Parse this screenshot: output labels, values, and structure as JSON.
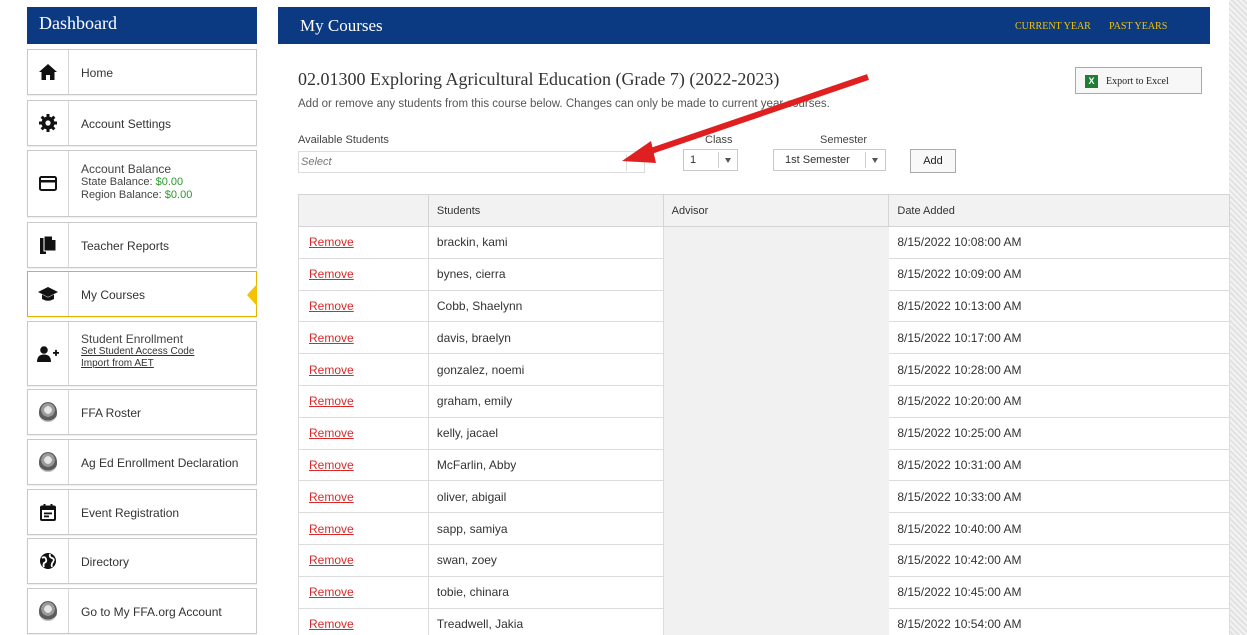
{
  "sidebar": {
    "title": "Dashboard",
    "items": [
      {
        "label": "Home",
        "icon": "home-icon"
      },
      {
        "label": "Account Settings",
        "icon": "gear-icon"
      },
      {
        "label": "Account Balance",
        "icon": "credit-card-icon",
        "lines": [
          {
            "prefix": "State Balance:",
            "value": "$0.00"
          },
          {
            "prefix": "Region Balance:",
            "value": "$0.00"
          }
        ]
      },
      {
        "label": "Teacher Reports",
        "icon": "copy-documents-icon"
      },
      {
        "label": "My Courses",
        "icon": "graduation-cap-icon",
        "active": true
      },
      {
        "label": "Student Enrollment",
        "icon": "add-user-icon",
        "links": [
          "Set Student Access Code",
          "Import from AET"
        ]
      },
      {
        "label": "FFA Roster",
        "icon": "ffa-emblem-icon"
      },
      {
        "label": "Ag Ed Enrollment Declaration",
        "icon": "ffa-emblem-icon"
      },
      {
        "label": "Event Registration",
        "icon": "calendar-icon"
      },
      {
        "label": "Directory",
        "icon": "globe-icon"
      },
      {
        "label": "Go to My FFA.org Account",
        "icon": "ffa-emblem-icon"
      }
    ]
  },
  "header": {
    "title": "My Courses",
    "links": [
      "CURRENT YEAR",
      "PAST YEARS"
    ]
  },
  "course": {
    "title": "02.01300 Exploring Agricultural Education (Grade 7) (2022-2023)",
    "subtitle": "Add or remove any students from this course below. Changes can only be made to current year courses.",
    "export_label": "Export to Excel",
    "export_icon_letter": "X"
  },
  "form": {
    "students_label": "Available Students",
    "students_placeholder": "Select",
    "class_label": "Class",
    "class_value": "1",
    "semester_label": "Semester",
    "semester_value": "1st Semester",
    "add_label": "Add"
  },
  "table": {
    "columns": [
      "",
      "Students",
      "Advisor",
      "Date Added"
    ],
    "remove_label": "Remove",
    "rows": [
      {
        "student": "brackin, kami",
        "date": "8/15/2022 10:08:00 AM"
      },
      {
        "student": "bynes, cierra",
        "date": "8/15/2022 10:09:00 AM"
      },
      {
        "student": "Cobb, Shaelynn",
        "date": "8/15/2022 10:13:00 AM"
      },
      {
        "student": "davis, braelyn",
        "date": "8/15/2022 10:17:00 AM"
      },
      {
        "student": "gonzalez, noemi",
        "date": "8/15/2022 10:28:00 AM"
      },
      {
        "student": "graham, emily",
        "date": "8/15/2022 10:20:00 AM"
      },
      {
        "student": "kelly, jacael",
        "date": "8/15/2022 10:25:00 AM"
      },
      {
        "student": "McFarlin, Abby",
        "date": "8/15/2022 10:31:00 AM"
      },
      {
        "student": "oliver, abigail",
        "date": "8/15/2022 10:33:00 AM"
      },
      {
        "student": "sapp, samiya",
        "date": "8/15/2022 10:40:00 AM"
      },
      {
        "student": "swan, zoey",
        "date": "8/15/2022 10:42:00 AM"
      },
      {
        "student": "tobie, chinara",
        "date": "8/15/2022 10:45:00 AM"
      },
      {
        "student": "Treadwell, Jakia",
        "date": "8/15/2022 10:54:00 AM"
      }
    ]
  },
  "colors": {
    "brand_blue": "#0b3a82",
    "gold": "#f2c300",
    "remove_red": "#d62a2a",
    "annotation_red": "#e02020"
  }
}
